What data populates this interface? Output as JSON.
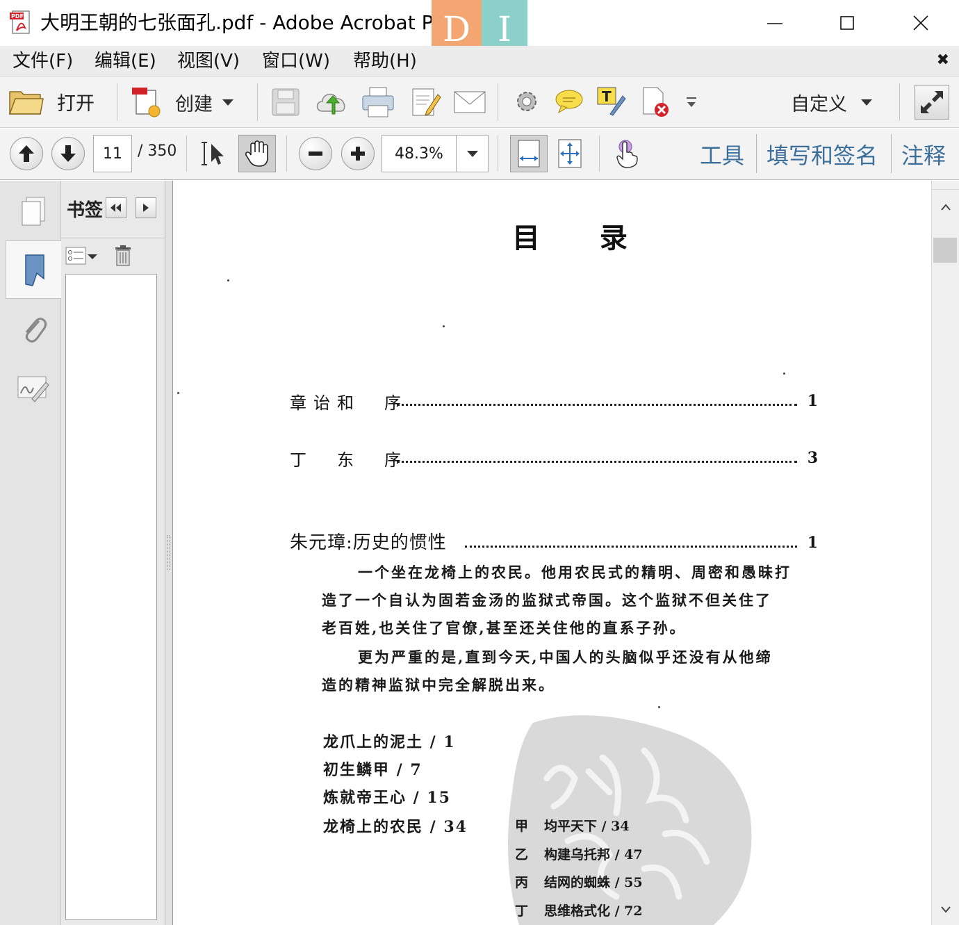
{
  "window": {
    "title": "大明王朝的七张面孔.pdf - Adobe Acrobat Pro",
    "overlay_badges": [
      "D",
      "I"
    ],
    "controls": [
      "minimize",
      "maximize",
      "close"
    ]
  },
  "menu": {
    "items": [
      "文件(F)",
      "编辑(E)",
      "视图(V)",
      "窗口(W)",
      "帮助(H)"
    ],
    "close_glyph": "✖"
  },
  "toolbar": {
    "open_label": "打开",
    "create_label": "创建",
    "customize_label": "自定义",
    "icons": [
      "save-icon",
      "cloud-upload-icon",
      "print-icon",
      "edit-document-icon",
      "email-icon",
      "gear-icon",
      "comment-icon",
      "typewriter-icon",
      "delete-document-icon",
      "more-tools-icon",
      "expand-icon"
    ]
  },
  "navbar": {
    "page_current": "11",
    "page_total": "/ 350",
    "zoom": "48.3%",
    "tabs": [
      "工具",
      "填写和签名",
      "注释"
    ]
  },
  "bookmarks_panel": {
    "title": "书签"
  },
  "document": {
    "heading": "目 录",
    "entries": [
      {
        "label": "章诒和　序",
        "page": "1"
      },
      {
        "label": "丁　东　序",
        "page": "3"
      },
      {
        "label": "朱元璋:历史的惯性",
        "page": "1"
      }
    ],
    "paragraph_lines": [
      "一个坐在龙椅上的农民。他用农民式的精明、周密和愚昧打",
      "造了一个自认为固若金汤的监狱式帝国。这个监狱不但关住了",
      "老百姓,也关住了官僚,甚至还关住他的直系子孙。",
      "更为严重的是,直到今天,中国人的头脑似乎还没有从他缔",
      "造的精神监狱中完全解脱出来。"
    ],
    "sections": [
      "龙爪上的泥土 / 1",
      "初生鳞甲 / 7",
      "炼就帝王心 / 15",
      "龙椅上的农民 / 34"
    ],
    "subsections": [
      {
        "mark": "甲",
        "text": "均平天下 / 34"
      },
      {
        "mark": "乙",
        "text": "构建乌托邦 / 47"
      },
      {
        "mark": "丙",
        "text": "结网的蜘蛛 / 55"
      },
      {
        "mark": "丁",
        "text": "思维格式化 / 72"
      }
    ]
  },
  "colors": {
    "toolbar_bg": "#f3f3f3",
    "menu_bg": "#ececec",
    "link_blue": "#3c6f9a",
    "badge_orange": "#f3a672",
    "badge_teal": "#8bd1c9",
    "pdf_red": "#d3222a"
  }
}
